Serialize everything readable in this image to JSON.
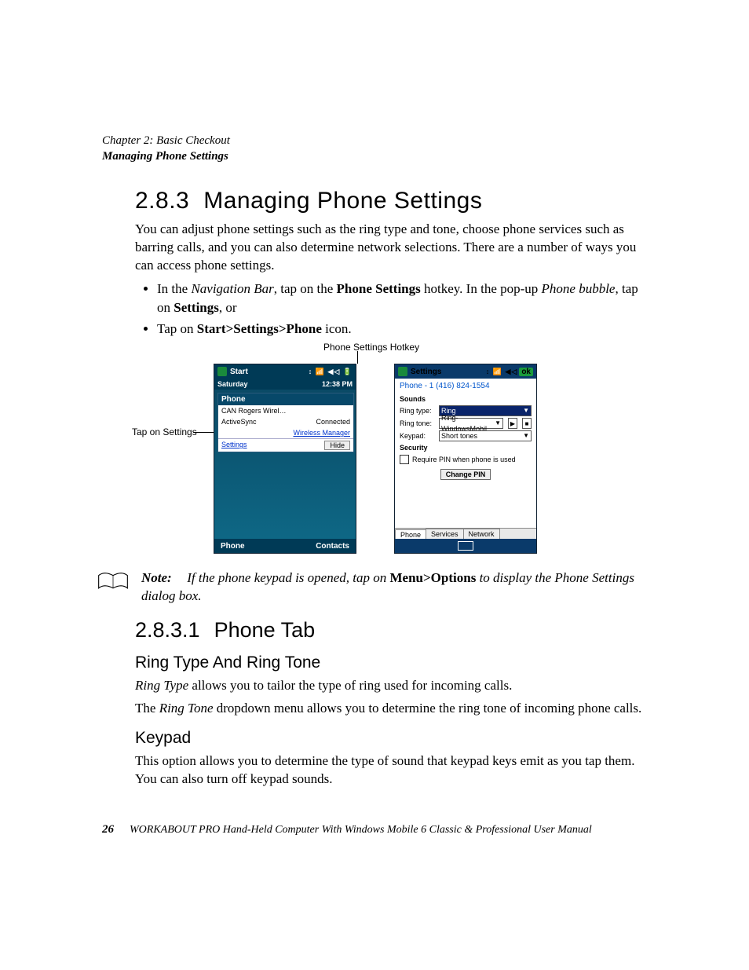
{
  "header": {
    "chapter": "Chapter  2:  Basic Checkout",
    "section": "Managing Phone Settings"
  },
  "title": {
    "number": "2.8.3",
    "text": "Managing Phone Settings"
  },
  "para1": "You can adjust phone settings such as the ring type and tone, choose phone services such as barring calls, and you can also determine network selections. There are a number of ways you can access phone settings.",
  "bullet1_pre": "In the ",
  "bullet1_nav": "Navigation Bar",
  "bullet1_mid": ", tap on the ",
  "bullet1_ps": "Phone Settings",
  "bullet1_mid2": " hotkey. In the pop-up ",
  "bullet1_pb": "Phone bubble",
  "bullet1_mid3": ", tap on ",
  "bullet1_set": "Settings",
  "bullet1_end": ", or",
  "bullet2_pre": "Tap on ",
  "bullet2_path": "Start>Settings>Phone",
  "bullet2_end": " icon.",
  "callouts": {
    "hotkey": "Phone Settings Hotkey",
    "tap_settings": "Tap on Settings"
  },
  "left_screen": {
    "title": "Start",
    "icons": "↕  📶 ◀◁ 🔋",
    "day": "Saturday",
    "time": "12:38 PM",
    "popup_title": "Phone",
    "carrier": "CAN Rogers Wirel…",
    "activesync": "ActiveSync",
    "connected": "Connected",
    "wireless_mgr": "Wireless Manager",
    "settings": "Settings",
    "hide": "Hide",
    "bottom_left": "Phone",
    "bottom_right": "Contacts"
  },
  "right_screen": {
    "title": "Settings",
    "icons": "↕  📶 ◀◁",
    "ok": "ok",
    "phone_number": "Phone - 1 (416) 824-1554",
    "sounds": "Sounds",
    "ring_type_label": "Ring type:",
    "ring_type_value": "Ring",
    "ring_tone_label": "Ring tone:",
    "ring_tone_value": "Ring-WindowsMobil",
    "keypad_label": "Keypad:",
    "keypad_value": "Short tones",
    "security": "Security",
    "require_pin": "Require PIN when phone is used",
    "change_pin": "Change PIN",
    "tab_phone": "Phone",
    "tab_services": "Services",
    "tab_network": "Network"
  },
  "note": {
    "label": "Note:",
    "pre": "If the phone keypad is opened, tap on ",
    "menu": "Menu>Options",
    "post": " to display the Phone Settings dialog box."
  },
  "subsection": {
    "number": "2.8.3.1",
    "text": "Phone Tab"
  },
  "h_ring": "Ring Type And Ring Tone",
  "ring_p1_pre": "Ring Type",
  "ring_p1_post": " allows you to tailor the type of ring used for incoming calls.",
  "ring_p2_pre": "The ",
  "ring_p2_em": "Ring Tone",
  "ring_p2_post": " dropdown menu allows you to determine the ring tone of incoming phone calls.",
  "h_keypad": "Keypad",
  "keypad_p": "This option allows you to determine the type of sound that keypad keys emit as you tap them. You can also turn off keypad sounds.",
  "footer": {
    "page": "26",
    "text": "WORKABOUT PRO Hand-Held Computer With Windows Mobile 6 Classic & Professional User Manual"
  }
}
